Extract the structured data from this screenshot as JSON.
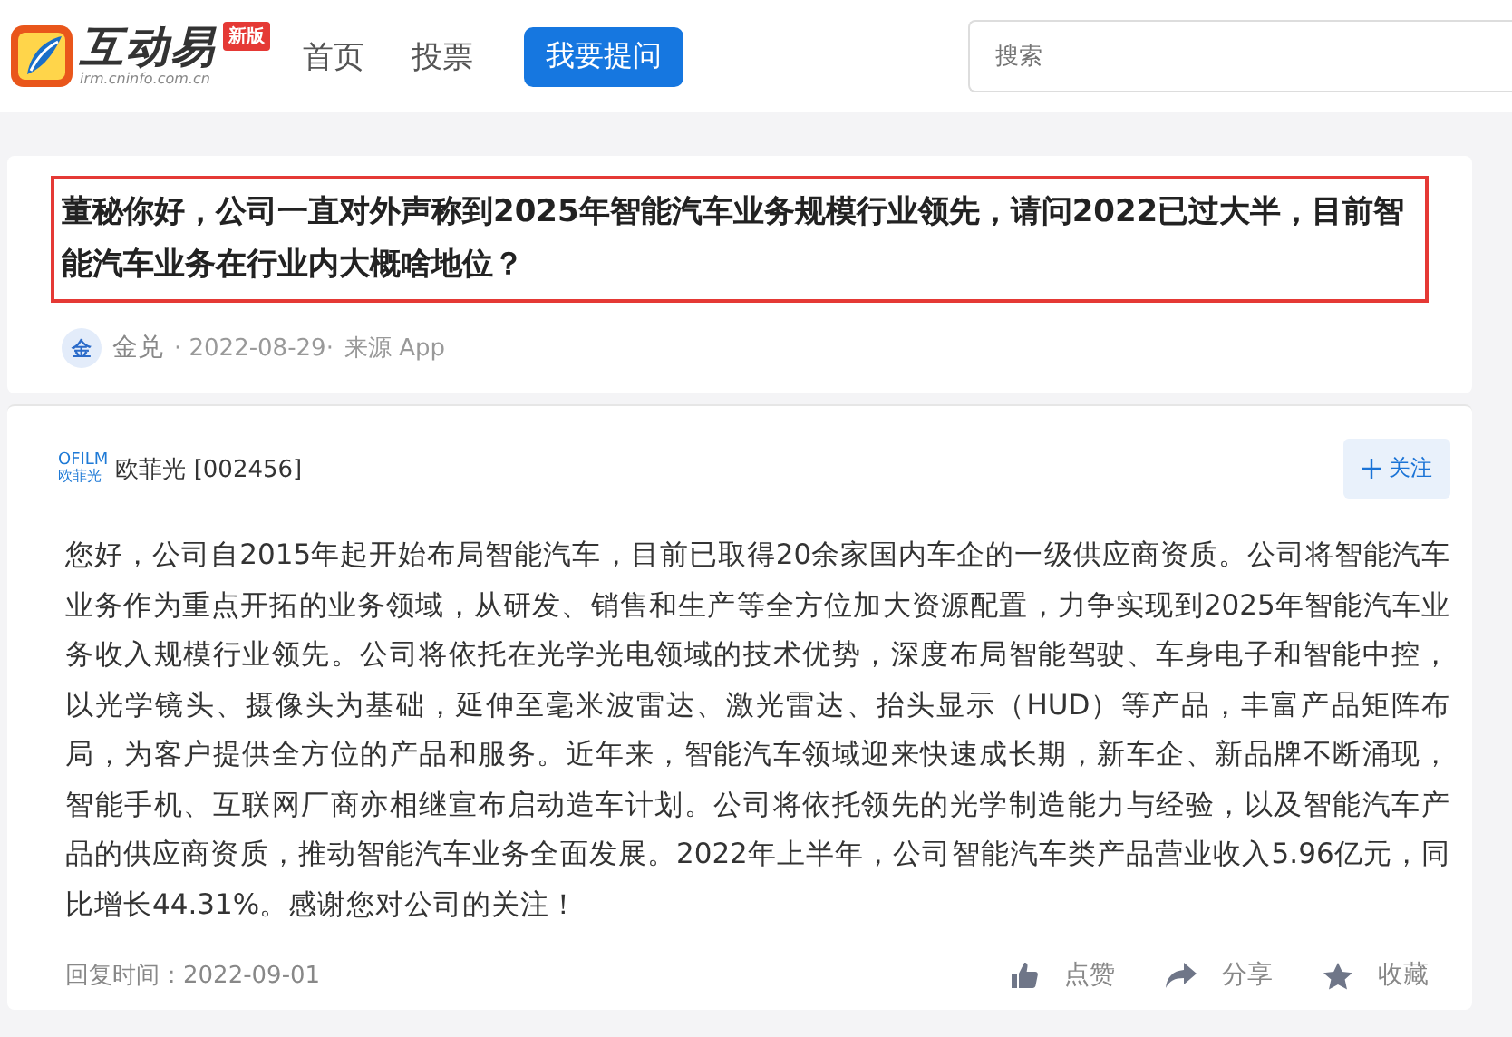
{
  "header": {
    "logo_text": "互动易",
    "logo_url": "irm.cninfo.com.cn",
    "badge": "新版",
    "nav": [
      {
        "label": "首页",
        "selected": false
      },
      {
        "label": "投票",
        "selected": false
      }
    ],
    "ask_button": "我要提问",
    "search": {
      "placeholder": "搜索"
    }
  },
  "question": {
    "text": "董秘你好，公司一直对外声称到2025年智能汽车业务规模行业领先，请问2022已过大半，目前智能汽车业务在行业内大概啥地位？",
    "avatar": "金",
    "author": "金兑",
    "date": "· 2022-08-29·",
    "source": "来源 App"
  },
  "answer": {
    "company_logo_top": "OFILM",
    "company_logo_bottom": "欧菲光",
    "company": "欧菲光 [002456]",
    "follow": "关注",
    "text": "您好，公司自2015年起开始布局智能汽车，目前已取得20余家国内车企的一级供应商资质。公司将智能汽车业务作为重点开拓的业务领域，从研发、销售和生产等全方位加大资源配置，力争实现到2025年智能汽车业务收入规模行业领先。公司将依托在光学光电领域的技术优势，深度布局智能驾驶、车身电子和智能中控，以光学镜头、摄像头为基础，延伸至毫米波雷达、激光雷达、抬头显示（HUD）等产品，丰富产品矩阵布局，为客户提供全方位的产品和服务。近年来，智能汽车领域迎来快速成长期，新车企、新品牌不断涌现，智能手机、互联网厂商亦相继宣布启动造车计划。公司将依托领先的光学制造能力与经验，以及智能汽车产品的供应商资质，推动智能汽车业务全面发展。2022年上半年，公司智能汽车类产品营业收入5.96亿元，同比增长44.31%。感谢您对公司的关注！",
    "reply_time": "回复时间：2022-09-01",
    "actions": [
      {
        "kind": "like",
        "label": "点赞"
      },
      {
        "kind": "share",
        "label": "分享"
      },
      {
        "kind": "favorite",
        "label": "收藏"
      }
    ]
  }
}
